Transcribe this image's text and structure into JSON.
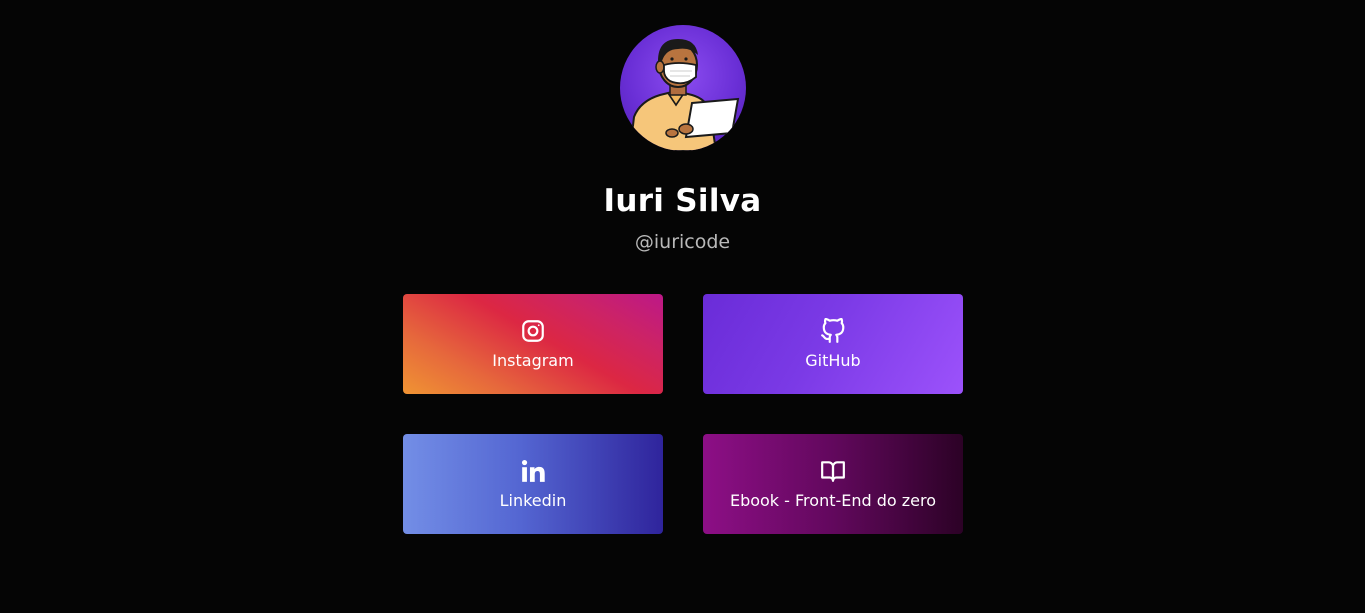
{
  "profile": {
    "name": "Iuri Silva",
    "handle": "@iuricode",
    "avatar_icon": "person-with-mask-and-laptop-illustration"
  },
  "links": [
    {
      "label": "Instagram",
      "icon": "instagram-icon",
      "colors": [
        "#f09433",
        "#dc2743",
        "#bc1888"
      ]
    },
    {
      "label": "GitHub",
      "icon": "github-icon",
      "colors": [
        "#6a2cd8",
        "#9c52fb"
      ]
    },
    {
      "label": "Linkedin",
      "icon": "linkedin-icon",
      "colors": [
        "#738ee6",
        "#2f249c"
      ]
    },
    {
      "label": "Ebook - Front-End do zero",
      "icon": "book-open-icon",
      "colors": [
        "#8d0f86",
        "#2c0226"
      ]
    }
  ],
  "theme": {
    "background": "#050505",
    "handle_color": "#b9b9b9"
  }
}
